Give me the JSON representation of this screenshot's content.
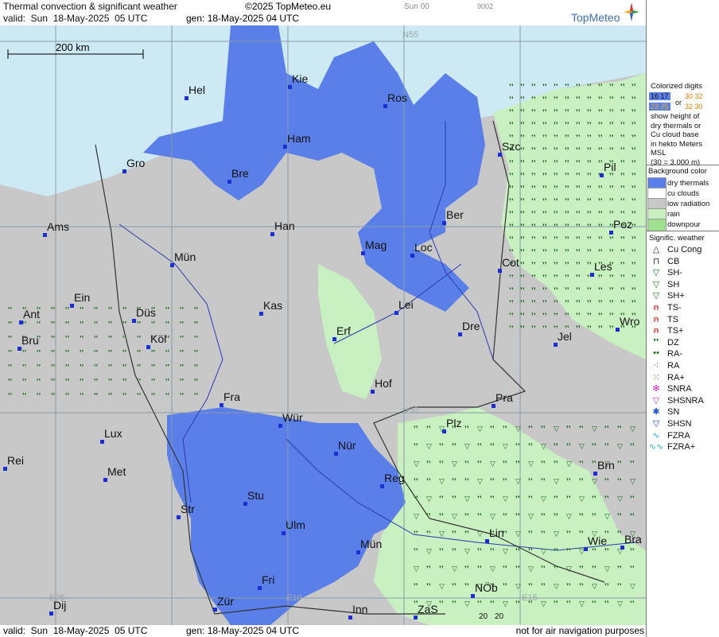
{
  "header": {
    "title": "Thermal convection & significant weather",
    "copyright": "©2025 TopMeteo.eu",
    "valid": "valid:  Sun  18-May-2025  05 UTC",
    "gen": "gen: 18-May-2025 04 UTC",
    "day_label": "Sun 00",
    "code": "9002",
    "logo": "TopMeteo"
  },
  "footer": {
    "valid": "valid:  Sun  18-May-2025  05 UTC",
    "gen": "gen: 18-May-2025 04 UTC",
    "note": "not for air navigation purposes"
  },
  "map": {
    "scale_label": "200 km",
    "grid_labels": [
      "N55",
      "N50",
      "E05",
      "E10",
      "E15"
    ],
    "cities": [
      "Hel",
      "Kie",
      "Ros",
      "Ham",
      "Szc",
      "Gro",
      "Bre",
      "Pil",
      "Ber",
      "Ams",
      "Han",
      "Poz",
      "Mag",
      "Loc",
      "Mün",
      "Cot",
      "Les",
      "Ein",
      "Kas",
      "Lei",
      "Ant",
      "Düs",
      "Wro",
      "Dre",
      "Erf",
      "Bru",
      "Köl",
      "Jel",
      "Hof",
      "Fra",
      "Pra",
      "Würt",
      "Plz",
      "Lux",
      "Nür",
      "Rei",
      "Met",
      "Brn",
      "Reg",
      "Stu",
      "Str",
      "Ulm",
      "Lin",
      "Mün2",
      "Wie",
      "Bra",
      "Fri",
      "NÖb",
      "Dij",
      "Zür",
      "Inn",
      "ZaS"
    ],
    "city_labels": {
      "Hel": "Hel",
      "Kie": "Kie",
      "Ros": "Ros",
      "Ham": "Ham",
      "Szc": "Szc",
      "Gro": "Gro",
      "Bre": "Bre",
      "Pil": "Pil",
      "Ber": "Ber",
      "Ams": "Ams",
      "Han": "Han",
      "Poz": "Poz",
      "Mag": "Mag",
      "Loc": "Loc",
      "Mün": "Mün",
      "Cot": "Cot",
      "Les": "Les",
      "Ein": "Ein",
      "Kas": "Kas",
      "Lei": "Lei",
      "Ant": "Ant",
      "Düs": "Düs",
      "Wro": "Wro",
      "Dre": "Dre",
      "Erf": "Erf",
      "Bru": "Bru",
      "Köl": "Köl",
      "Jel": "Jel",
      "Hof": "Hof",
      "Fra": "Fra",
      "Pra": "Pra",
      "Würt": "Wür",
      "Plz": "Plz",
      "Lux": "Lux",
      "Nür": "Nür",
      "Rei": "Rei",
      "Met": "Met",
      "Brn": "Brn",
      "Reg": "Reg",
      "Stu": "Stu",
      "Str": "Str",
      "Ulm": "Ulm",
      "Lin": "Lin",
      "Mün2": "Mün",
      "Wie": "Wie",
      "Bra": "Bra",
      "Fri": "Fri",
      "NÖb": "NÖb",
      "Dij": "Dij",
      "Zür": "Zür",
      "Inn": "Inn",
      "ZaS": "ZaS"
    },
    "digit_labels": [
      "20",
      "20"
    ]
  },
  "legend": {
    "colorized_title": "Colorized digits",
    "digits_a1": "16 17",
    "digits_a2": "30 32",
    "or": "or",
    "digits_b1": "23 25",
    "digits_b2": "32 30",
    "explain": [
      "show height of",
      "dry thermals or",
      "Cu cloud base",
      "in hekto Meters",
      "MSL",
      "(30 = 3.000 m)"
    ],
    "bg_title": "Background color",
    "bg_items": [
      {
        "label": "dry thermals",
        "color": "#5b7fe8"
      },
      {
        "label": "cu clouds",
        "color": "#ffffff"
      },
      {
        "label": "low radiation",
        "color": "#c8c8c8"
      },
      {
        "label": "rain",
        "color": "#c8f0c0"
      },
      {
        "label": "downpour",
        "color": "#9ee08e"
      }
    ],
    "sig_title": "Signific. weather",
    "sig_items": [
      {
        "label": "Cu Cong",
        "icon": "cu-cong-icon",
        "glyph": "△",
        "color": "#333333"
      },
      {
        "label": "CB",
        "icon": "cb-icon",
        "glyph": "⊓",
        "color": "#333333"
      },
      {
        "label": "SH-",
        "icon": "shower-light-icon",
        "glyph": "▽",
        "color": "#1a7a1a"
      },
      {
        "label": "SH",
        "icon": "shower-icon",
        "glyph": "▽",
        "color": "#1a7a1a"
      },
      {
        "label": "SH+",
        "icon": "shower-heavy-icon",
        "glyph": "▽",
        "color": "#1a7a1a"
      },
      {
        "label": "TS-",
        "icon": "thunderstorm-light-icon",
        "glyph": "ꞥ",
        "color": "#d02020"
      },
      {
        "label": "TS",
        "icon": "thunderstorm-icon",
        "glyph": "ꞥ",
        "color": "#d02020"
      },
      {
        "label": "TS+",
        "icon": "thunderstorm-heavy-icon",
        "glyph": "ꞥ",
        "color": "#d02020"
      },
      {
        "label": "DZ",
        "icon": "drizzle-icon",
        "glyph": "❜❜",
        "color": "#1a6a1a"
      },
      {
        "label": "RA-",
        "icon": "rain-light-icon",
        "glyph": "••",
        "color": "#1a6a1a"
      },
      {
        "label": "RA",
        "icon": "rain-icon",
        "glyph": "⁖",
        "color": "#1a6a1a"
      },
      {
        "label": "RA+",
        "icon": "rain-heavy-icon",
        "glyph": "⁙",
        "color": "#1a6a1a"
      },
      {
        "label": "SNRA",
        "icon": "snow-rain-icon",
        "glyph": "✻",
        "color": "#d030c0"
      },
      {
        "label": "SHSNRA",
        "icon": "shower-snow-rain-icon",
        "glyph": "▽",
        "color": "#d030c0"
      },
      {
        "label": "SN",
        "icon": "snow-icon",
        "glyph": "✱",
        "color": "#2050d0"
      },
      {
        "label": "SHSN",
        "icon": "shower-snow-icon",
        "glyph": "▽",
        "color": "#2050d0"
      },
      {
        "label": "FZRA",
        "icon": "freezing-rain-icon",
        "glyph": "∿",
        "color": "#20b0e0"
      },
      {
        "label": "FZRA+",
        "icon": "freezing-rain-heavy-icon",
        "glyph": "∿∿",
        "color": "#20b0e0"
      }
    ]
  }
}
